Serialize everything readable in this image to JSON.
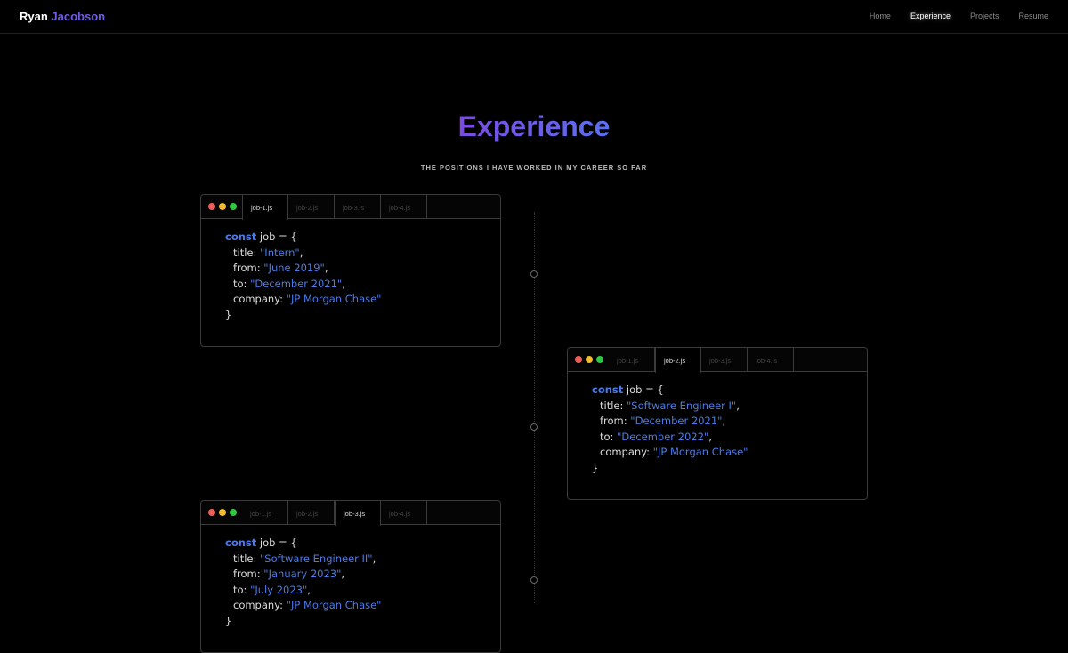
{
  "header": {
    "brand_first": "Ryan",
    "brand_last": "Jacobson",
    "nav": [
      "Home",
      "Experience",
      "Projects",
      "Resume"
    ],
    "active": "Experience"
  },
  "page": {
    "title": "Experience",
    "subtitle": "THE POSITIONS I HAVE WORKED IN MY CAREER SO FAR"
  },
  "code": {
    "keyword": "const",
    "var": " job = {",
    "close": "}",
    "keys": {
      "title": "title: ",
      "from": "from: ",
      "to": "to: ",
      "company": "company: "
    }
  },
  "tabs": [
    "job-1.js",
    "job-2.js",
    "job-3.js",
    "job-4.js"
  ],
  "jobs": [
    {
      "title": "\"Intern\"",
      "from": "\"June 2019\"",
      "to": "\"December 2021\"",
      "company": "\"JP Morgan Chase\""
    },
    {
      "title": "\"Software Engineer I\"",
      "from": "\"December 2021\"",
      "to": "\"December 2022\"",
      "company": "\"JP Morgan Chase\""
    },
    {
      "title": "\"Software Engineer II\"",
      "from": "\"January 2023\"",
      "to": "\"July 2023\"",
      "company": "\"JP Morgan Chase\""
    }
  ],
  "colors": {
    "accent": "#4a7be8",
    "purple": "#7b4be0"
  }
}
